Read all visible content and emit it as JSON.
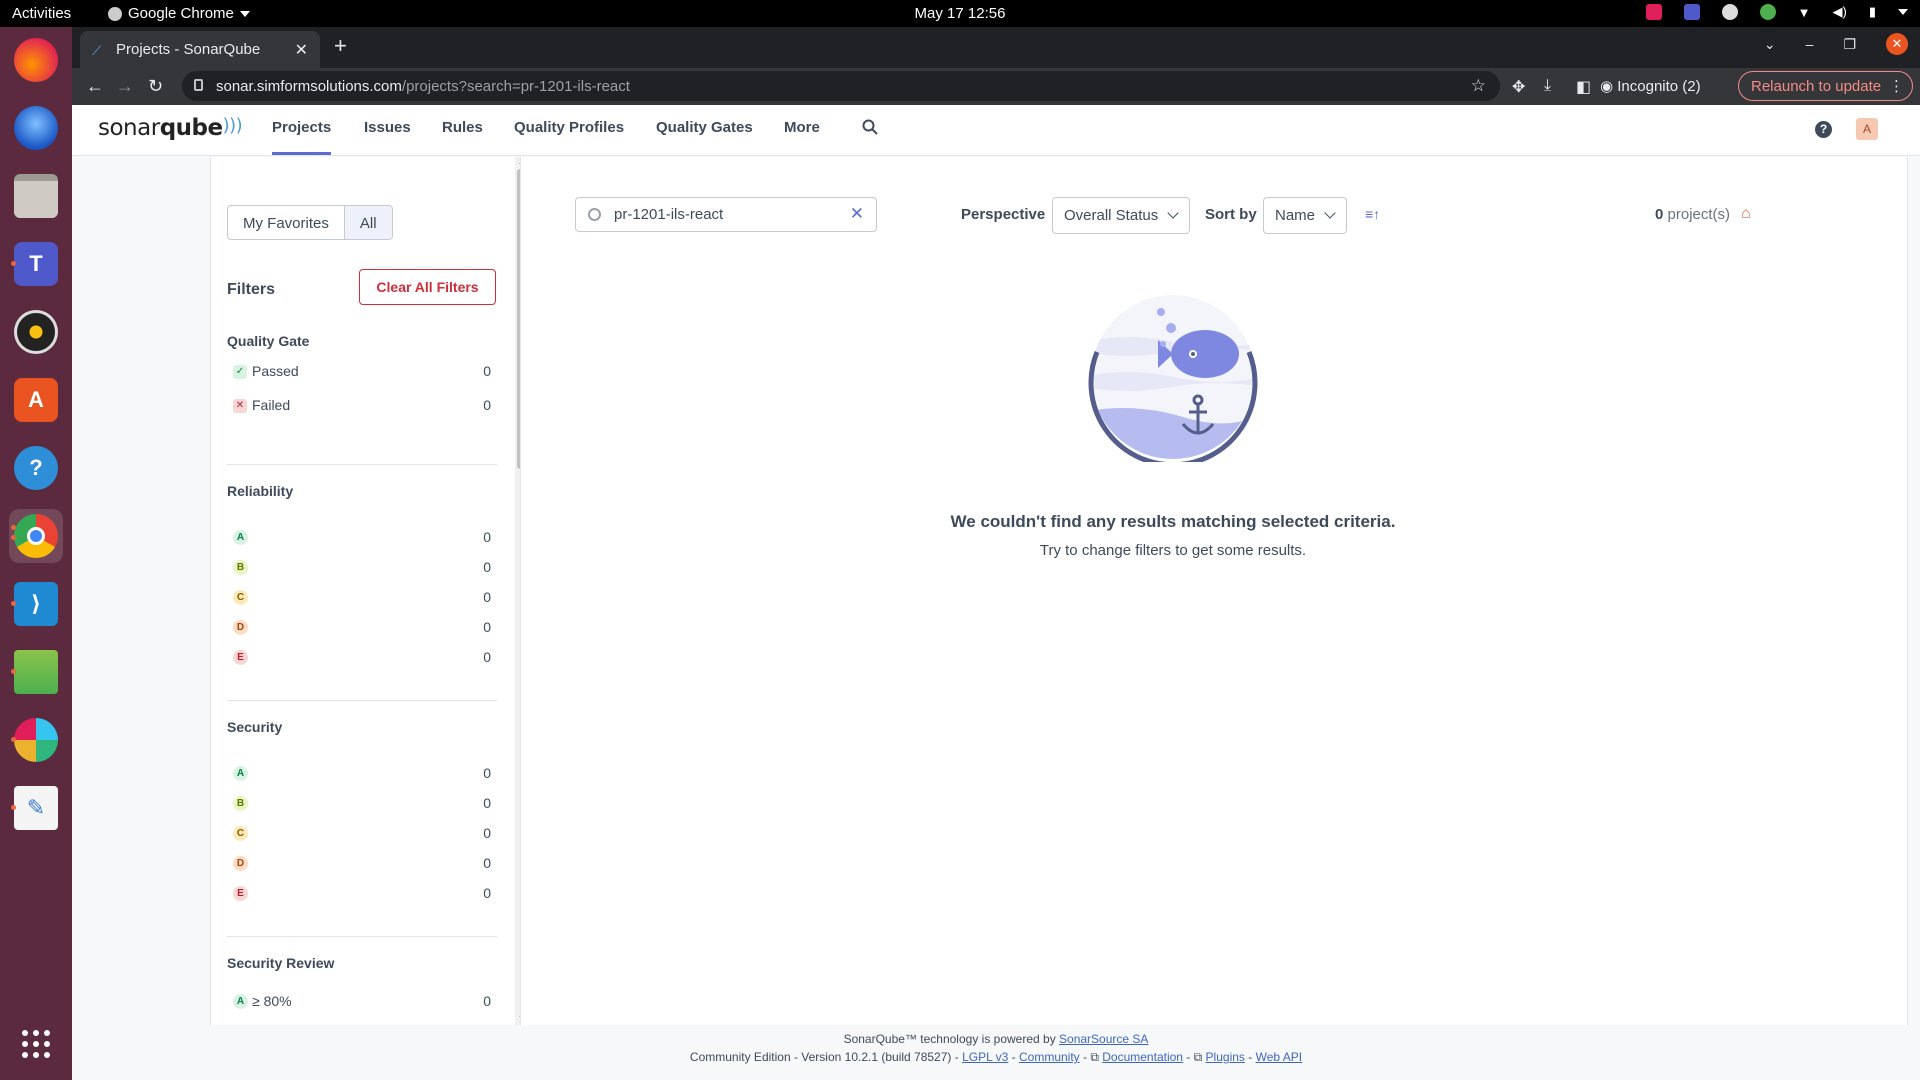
{
  "system": {
    "activities": "Activities",
    "app_name": "Google Chrome",
    "clock": "May 17  12:56"
  },
  "browser": {
    "tab_title": "Projects - SonarQube",
    "url_host": "sonar.simformsolutions.com",
    "url_path": "/projects?search=pr-1201-ils-react",
    "incognito": "Incognito (2)",
    "relaunch": "Relaunch to update"
  },
  "sonar": {
    "logo_a": "sonar",
    "logo_b": "qube",
    "nav": [
      "Projects",
      "Issues",
      "Rules",
      "Quality Profiles",
      "Quality Gates",
      "More"
    ],
    "help": "?",
    "avatar": "A"
  },
  "sidebar": {
    "fav_my": "My Favorites",
    "fav_all": "All",
    "filters_title": "Filters",
    "clear_all": "Clear All Filters",
    "quality_gate": {
      "title": "Quality Gate",
      "items": [
        {
          "label": "Passed",
          "count": "0"
        },
        {
          "label": "Failed",
          "count": "0"
        }
      ]
    },
    "reliability": {
      "title": "Reliability",
      "items": [
        {
          "label": "A",
          "count": "0"
        },
        {
          "label": "B",
          "count": "0"
        },
        {
          "label": "C",
          "count": "0"
        },
        {
          "label": "D",
          "count": "0"
        },
        {
          "label": "E",
          "count": "0"
        }
      ]
    },
    "security": {
      "title": "Security",
      "items": [
        {
          "label": "A",
          "count": "0"
        },
        {
          "label": "B",
          "count": "0"
        },
        {
          "label": "C",
          "count": "0"
        },
        {
          "label": "D",
          "count": "0"
        },
        {
          "label": "E",
          "count": "0"
        }
      ]
    },
    "security_review": {
      "title": "Security Review",
      "first_item": {
        "rating": "A",
        "label": "≥ 80%",
        "count": "0"
      }
    }
  },
  "results": {
    "search_value": "pr-1201-ils-react",
    "perspective_label": "Perspective",
    "perspective_value": "Overall Status",
    "sortby_label": "Sort by",
    "sortby_value": "Name",
    "count_num": "0",
    "count_suffix": " project(s)",
    "empty_title": "We couldn't find any results matching selected criteria.",
    "empty_sub": "Try to change filters to get some results."
  },
  "footer": {
    "line1_prefix": "SonarQube™ technology is powered by ",
    "line1_link": "SonarSource SA",
    "line2_prefix": "Community Edition - Version 10.2.1 (build 78527) - ",
    "lgpl": "LGPL v3",
    "community": "Community",
    "documentation": "Documentation",
    "plugins": "Plugins",
    "webapi": "Web API",
    "sep": " - "
  },
  "colors": {
    "accent": "#5d6cd0",
    "danger": "#d02f3a",
    "dock": "#5b2a3e"
  }
}
